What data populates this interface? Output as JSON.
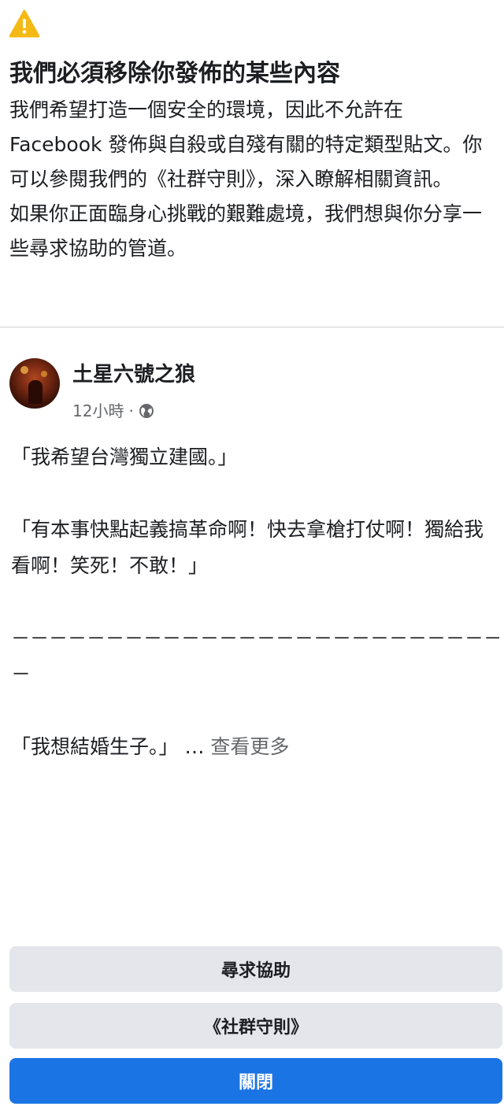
{
  "notice": {
    "title": "我們必須移除你發佈的某些內容",
    "body_p1": "我們希望打造一個安全的環境，因此不允許在 Facebook 發佈與自殺或自殘有關的特定類型貼文。你可以參閱我們的《社群守則》，深入瞭解相關資訊。",
    "body_p2": "如果你正面臨身心挑戰的艱難處境，我們想與你分享一些尋求協助的管道。",
    "icon": "warning-icon",
    "accent": "#f5b915"
  },
  "post": {
    "author": "土星六號之狼",
    "time": "12小時",
    "separator": "·",
    "audience_icon": "globe-icon",
    "lines": {
      "l1": "「我希望台灣獨立建國。」",
      "l2": "「有本事快點起義搞革命啊！快去拿槍打仗啊！獨給我看啊！笑死！不敢！」",
      "l3": "－－－－－－－－－－－－－－－－－－－－－－－－－－",
      "l4": "「我想結婚生子。」",
      "ellipsis": " … ",
      "see_more": "查看更多"
    }
  },
  "actions": {
    "get_help": "尋求協助",
    "community_standards": "《社群守則》",
    "close": "關閉"
  },
  "colors": {
    "primary_blue": "#1b74e4",
    "button_gray": "#e4e6eb",
    "secondary_text": "#65676b"
  }
}
